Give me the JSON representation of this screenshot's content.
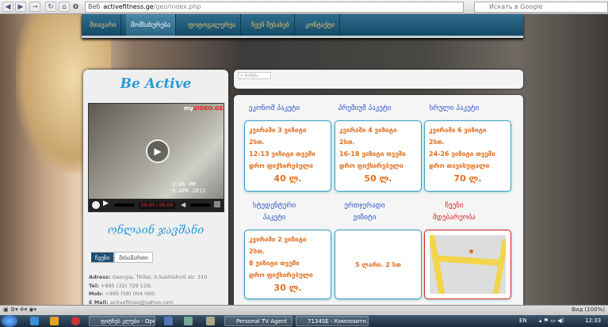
{
  "browser": {
    "back": "◀",
    "forward": "▶",
    "home": "⌂",
    "url_label": "Веб",
    "url_domain": "activefitness.ge",
    "url_path": "/geo/index.php",
    "search_placeholder": "Искать в Google",
    "zoom": "Вид (100%)"
  },
  "nav": {
    "items": [
      {
        "label": "მთავარი"
      },
      {
        "label": "მომსახურება",
        "active": true
      },
      {
        "label": "ფოტოგალერეა"
      },
      {
        "label": "ჩვენ შესახებ"
      },
      {
        "label": "კონტაქტი"
      }
    ]
  },
  "sidebar": {
    "title": "Be Active",
    "video": {
      "brand_a": "my",
      "brand_b": "VIDEO.GE",
      "stamp_time": "2:46 PM",
      "stamp_date": "9.APR.2011",
      "time": "00:00 / 00:00"
    },
    "script_text": "ონლაინ ჯავშანი",
    "tabs": [
      {
        "label": "ჩვენი"
      },
      {
        "label": "მისამართი"
      }
    ],
    "address": {
      "adress_label": "Adress:",
      "adress": " Georgia, Tbilisi, II.Sukhishvili str. 310",
      "tel_label": "Tel:",
      "tel": " +995 (32) 729 129;",
      "mob_label": "Mob:",
      "mob": " +995 (58) 004 060;",
      "mail_label": "E Mail:",
      "mail": " activefitnes@yahoo.com"
    }
  },
  "topbar": {
    "button": "✔ მომენა"
  },
  "packages": [
    {
      "title": "ეკონომ პაკეტი",
      "lines": [
        "კვირაში 3 ვიზიტი",
        "2სთ.",
        "12-13 ვიზიტი თვეში",
        "დრო ფიქსირებული"
      ],
      "price": "40 ლ."
    },
    {
      "title": "პრემიუმ პაკეტი",
      "lines": [
        "კვირაში 4 ვიზიტი",
        "2სთ.",
        "16-18 ვიზიტი თვეში",
        "დრო ფიქსირებული"
      ],
      "price": "50 ლ."
    },
    {
      "title": "სრული პაკეტი",
      "lines": [
        "კვირაში 6 ვიზიტი",
        "2სთ.",
        "24-26 ვიზიტი თვეში",
        "დრო თავისუფალი"
      ],
      "price": "70 ლ."
    },
    {
      "title": "სტუდენტური პაკეტი",
      "lines": [
        "კვირაში 2 ვიზიტი",
        "2სთ.",
        "8 ვიზიტი თვეში",
        "დრო ფიქსირებული"
      ],
      "price": "30 ლ."
    },
    {
      "title": "ერთჯერადი ვიზიტი",
      "single": "5 ლარი. 2 სთ"
    },
    {
      "title": "ჩვენი მდებარეობა"
    }
  ],
  "colors": {
    "accent": "#2a9ad8",
    "title": "#2d55c9",
    "price": "#e07020",
    "location": "#d82020",
    "nav": "#144a67"
  },
  "taskbar": {
    "tasks": [
      "ფიტნეს კლუბი - Opera",
      "Personal TV Agent",
      "7134SE - Композитн..."
    ],
    "lang": "EN",
    "clock": "12:33"
  }
}
